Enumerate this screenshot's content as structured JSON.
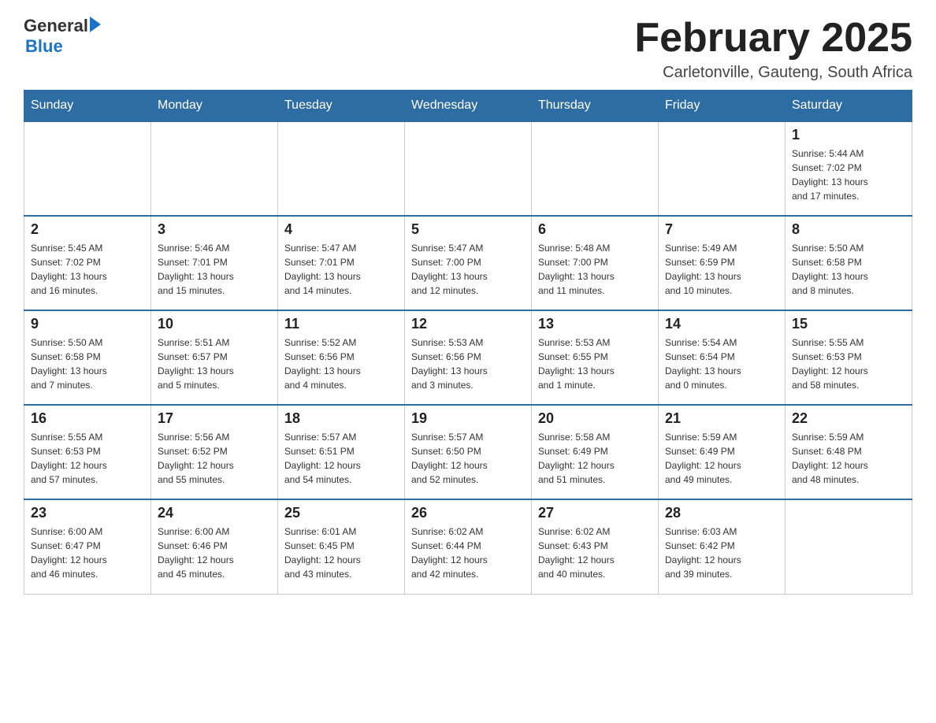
{
  "header": {
    "logo": {
      "general": "General",
      "blue": "Blue"
    },
    "title": "February 2025",
    "location": "Carletonville, Gauteng, South Africa"
  },
  "weekdays": [
    "Sunday",
    "Monday",
    "Tuesday",
    "Wednesday",
    "Thursday",
    "Friday",
    "Saturday"
  ],
  "weeks": [
    {
      "days": [
        {
          "date": "",
          "info": ""
        },
        {
          "date": "",
          "info": ""
        },
        {
          "date": "",
          "info": ""
        },
        {
          "date": "",
          "info": ""
        },
        {
          "date": "",
          "info": ""
        },
        {
          "date": "",
          "info": ""
        },
        {
          "date": "1",
          "info": "Sunrise: 5:44 AM\nSunset: 7:02 PM\nDaylight: 13 hours\nand 17 minutes."
        }
      ]
    },
    {
      "days": [
        {
          "date": "2",
          "info": "Sunrise: 5:45 AM\nSunset: 7:02 PM\nDaylight: 13 hours\nand 16 minutes."
        },
        {
          "date": "3",
          "info": "Sunrise: 5:46 AM\nSunset: 7:01 PM\nDaylight: 13 hours\nand 15 minutes."
        },
        {
          "date": "4",
          "info": "Sunrise: 5:47 AM\nSunset: 7:01 PM\nDaylight: 13 hours\nand 14 minutes."
        },
        {
          "date": "5",
          "info": "Sunrise: 5:47 AM\nSunset: 7:00 PM\nDaylight: 13 hours\nand 12 minutes."
        },
        {
          "date": "6",
          "info": "Sunrise: 5:48 AM\nSunset: 7:00 PM\nDaylight: 13 hours\nand 11 minutes."
        },
        {
          "date": "7",
          "info": "Sunrise: 5:49 AM\nSunset: 6:59 PM\nDaylight: 13 hours\nand 10 minutes."
        },
        {
          "date": "8",
          "info": "Sunrise: 5:50 AM\nSunset: 6:58 PM\nDaylight: 13 hours\nand 8 minutes."
        }
      ]
    },
    {
      "days": [
        {
          "date": "9",
          "info": "Sunrise: 5:50 AM\nSunset: 6:58 PM\nDaylight: 13 hours\nand 7 minutes."
        },
        {
          "date": "10",
          "info": "Sunrise: 5:51 AM\nSunset: 6:57 PM\nDaylight: 13 hours\nand 5 minutes."
        },
        {
          "date": "11",
          "info": "Sunrise: 5:52 AM\nSunset: 6:56 PM\nDaylight: 13 hours\nand 4 minutes."
        },
        {
          "date": "12",
          "info": "Sunrise: 5:53 AM\nSunset: 6:56 PM\nDaylight: 13 hours\nand 3 minutes."
        },
        {
          "date": "13",
          "info": "Sunrise: 5:53 AM\nSunset: 6:55 PM\nDaylight: 13 hours\nand 1 minute."
        },
        {
          "date": "14",
          "info": "Sunrise: 5:54 AM\nSunset: 6:54 PM\nDaylight: 13 hours\nand 0 minutes."
        },
        {
          "date": "15",
          "info": "Sunrise: 5:55 AM\nSunset: 6:53 PM\nDaylight: 12 hours\nand 58 minutes."
        }
      ]
    },
    {
      "days": [
        {
          "date": "16",
          "info": "Sunrise: 5:55 AM\nSunset: 6:53 PM\nDaylight: 12 hours\nand 57 minutes."
        },
        {
          "date": "17",
          "info": "Sunrise: 5:56 AM\nSunset: 6:52 PM\nDaylight: 12 hours\nand 55 minutes."
        },
        {
          "date": "18",
          "info": "Sunrise: 5:57 AM\nSunset: 6:51 PM\nDaylight: 12 hours\nand 54 minutes."
        },
        {
          "date": "19",
          "info": "Sunrise: 5:57 AM\nSunset: 6:50 PM\nDaylight: 12 hours\nand 52 minutes."
        },
        {
          "date": "20",
          "info": "Sunrise: 5:58 AM\nSunset: 6:49 PM\nDaylight: 12 hours\nand 51 minutes."
        },
        {
          "date": "21",
          "info": "Sunrise: 5:59 AM\nSunset: 6:49 PM\nDaylight: 12 hours\nand 49 minutes."
        },
        {
          "date": "22",
          "info": "Sunrise: 5:59 AM\nSunset: 6:48 PM\nDaylight: 12 hours\nand 48 minutes."
        }
      ]
    },
    {
      "days": [
        {
          "date": "23",
          "info": "Sunrise: 6:00 AM\nSunset: 6:47 PM\nDaylight: 12 hours\nand 46 minutes."
        },
        {
          "date": "24",
          "info": "Sunrise: 6:00 AM\nSunset: 6:46 PM\nDaylight: 12 hours\nand 45 minutes."
        },
        {
          "date": "25",
          "info": "Sunrise: 6:01 AM\nSunset: 6:45 PM\nDaylight: 12 hours\nand 43 minutes."
        },
        {
          "date": "26",
          "info": "Sunrise: 6:02 AM\nSunset: 6:44 PM\nDaylight: 12 hours\nand 42 minutes."
        },
        {
          "date": "27",
          "info": "Sunrise: 6:02 AM\nSunset: 6:43 PM\nDaylight: 12 hours\nand 40 minutes."
        },
        {
          "date": "28",
          "info": "Sunrise: 6:03 AM\nSunset: 6:42 PM\nDaylight: 12 hours\nand 39 minutes."
        },
        {
          "date": "",
          "info": ""
        }
      ]
    }
  ]
}
